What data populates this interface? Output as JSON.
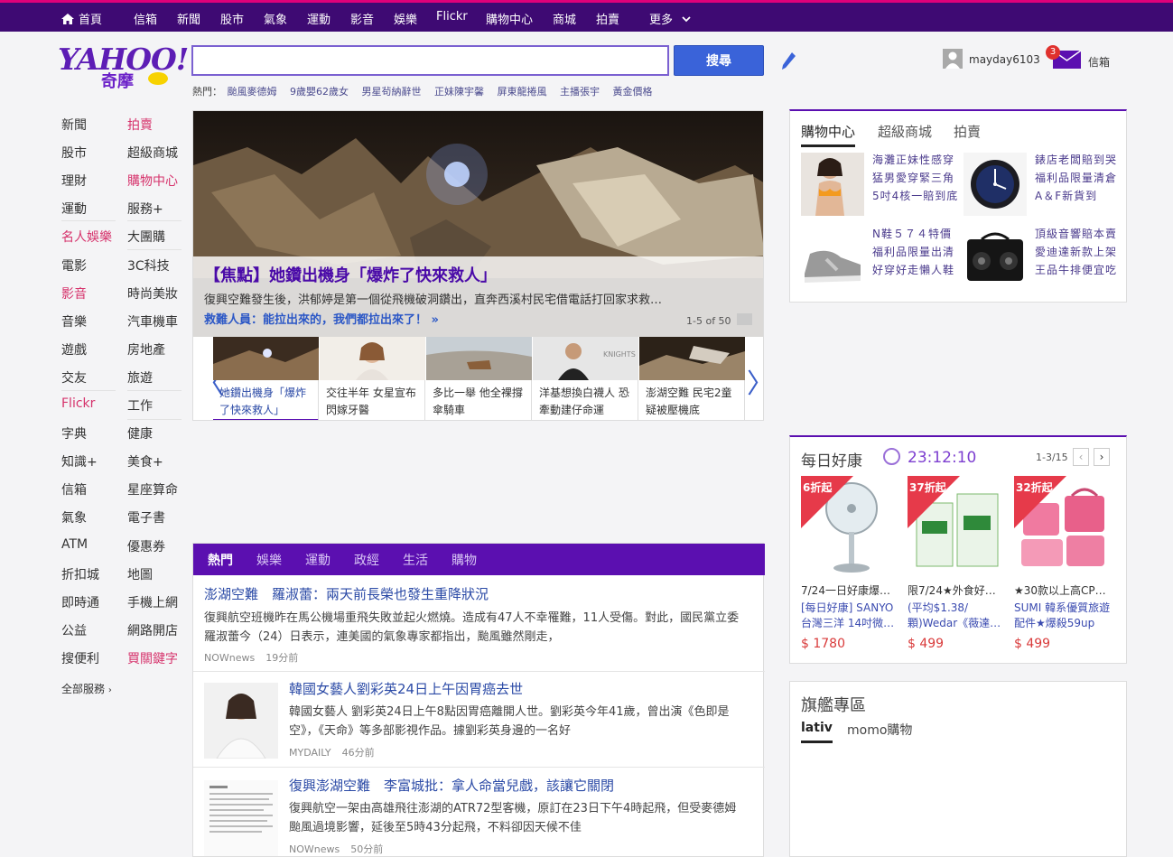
{
  "topnav": {
    "items": [
      "首頁",
      "信箱",
      "新聞",
      "股市",
      "氣象",
      "運動",
      "影音",
      "娛樂",
      "Flickr",
      "購物中心",
      "商城",
      "拍賣",
      "更多"
    ]
  },
  "header": {
    "logo_text": "YAHOO!",
    "logo_sub": "奇摩",
    "search_placeholder": "",
    "search_button": "搜尋",
    "hot_label": "熱門：",
    "hot_links": [
      "颱風麥德姆",
      "9歲嬰62歲女",
      "男星茍納辭世",
      "正妹陳宇馨",
      "屏東龍捲風",
      "主播張宇",
      "黃金價格"
    ],
    "username": "mayday6103",
    "mail_count": "3",
    "mail_label": "信箱"
  },
  "leftnav": {
    "col1": [
      {
        "label": "新聞",
        "red": false
      },
      {
        "label": "股市",
        "red": false
      },
      {
        "label": "理財",
        "red": false
      },
      {
        "label": "運動",
        "red": false
      },
      {
        "label": "名人娛樂",
        "red": true
      },
      {
        "label": "電影",
        "red": false
      },
      {
        "label": "影音",
        "red": true
      },
      {
        "label": "音樂",
        "red": false
      },
      {
        "label": "遊戲",
        "red": false
      },
      {
        "label": "交友",
        "red": false
      },
      {
        "label": "Flickr",
        "red": true
      },
      {
        "label": "字典",
        "red": false
      },
      {
        "label": "知識+",
        "red": false
      },
      {
        "label": "信箱",
        "red": false
      },
      {
        "label": "氣象",
        "red": false
      },
      {
        "label": "ATM",
        "red": false
      },
      {
        "label": "折扣城",
        "red": false
      },
      {
        "label": "即時通",
        "red": false
      },
      {
        "label": "公益",
        "red": false
      },
      {
        "label": "搜便利",
        "red": false
      }
    ],
    "col2": [
      {
        "label": "拍賣",
        "red": true
      },
      {
        "label": "超級商城",
        "red": false
      },
      {
        "label": "購物中心",
        "red": true
      },
      {
        "label": "服務+",
        "red": false
      },
      {
        "label": "大團購",
        "red": false
      },
      {
        "label": "3C科技",
        "red": false
      },
      {
        "label": "時尚美妝",
        "red": false
      },
      {
        "label": "汽車機車",
        "red": false
      },
      {
        "label": "房地產",
        "red": false
      },
      {
        "label": "旅遊",
        "red": false
      },
      {
        "label": "工作",
        "red": false
      },
      {
        "label": "健康",
        "red": false
      },
      {
        "label": "美食+",
        "red": false
      },
      {
        "label": "星座算命",
        "red": false
      },
      {
        "label": "電子書",
        "red": false
      },
      {
        "label": "優惠券",
        "red": false
      },
      {
        "label": "地圖",
        "red": false
      },
      {
        "label": "手機上網",
        "red": false
      },
      {
        "label": "網路開店",
        "red": false
      },
      {
        "label": "買關鍵字",
        "red": true
      }
    ],
    "all_services": "全部服務"
  },
  "hero": {
    "title": "【焦點】她鑽出機身「爆炸了快來救人」",
    "desc": "復興空難發生後，洪郁婷是第一個從飛機破洞鑽出，直奔西溪村民宅借電話打回家求救…",
    "more": "救難人員：能拉出來的，我們都拉出來了！ »",
    "count": "1-5 of 50",
    "thumbs": [
      {
        "caption": "她鑽出機身「爆炸了快來救人」"
      },
      {
        "caption": "交往半年 女星宣布閃嫁牙醫"
      },
      {
        "caption": "多比一舉 他全裸撐傘騎車"
      },
      {
        "caption": "洋基想換白襪人 恐牽動建仔命運"
      },
      {
        "caption": "澎湖空難 民宅2童疑被壓機底"
      }
    ]
  },
  "news": {
    "tabs": [
      "熱門",
      "娛樂",
      "運動",
      "政經",
      "生活",
      "購物"
    ],
    "items": [
      {
        "title": "澎湖空難　羅淑蕾：兩天前長榮也發生重降狀況",
        "body": "復興航空班機昨在馬公機場重飛失敗並起火燃燒。造成有47人不幸罹難，11人受傷。對此，國民黨立委羅淑蕾今（24）日表示，連美國的氣象專家都指出，颱風雖然剛走，",
        "source": "NOWnews",
        "time": "19分前"
      },
      {
        "title": "韓國女藝人劉彩英24日上午因胃癌去世",
        "body": "韓國女藝人 劉彩英24日上午8點因胃癌離開人世。劉彩英今年41歲，曾出演《色即是空》，《天命》等多部影視作品。據劉彩英身邊的一名好",
        "source": "MYDAILY",
        "time": "46分前"
      },
      {
        "title": "復興澎湖空難　李富城批：拿人命當兒戲，該讓它關閉",
        "body": "復興航空一架由高雄飛往澎湖的ATR72型客機，原訂在23日下午4時起飛，但受麥德姆颱風過境影響，延後至5時43分起飛，不料卻因天候不佳",
        "source": "NOWnews",
        "time": "50分前"
      }
    ]
  },
  "shop": {
    "tabs": [
      "購物中心",
      "超級商城",
      "拍賣"
    ],
    "items": [
      {
        "text": "海灘正妹性感穿 猛男愛穿緊三角 5吋4核一賠到底"
      },
      {
        "text": "錶店老闆賠到哭 福利品限量清倉 A＆F新貨到"
      },
      {
        "text": "N鞋５７４特價 福利品限量出清 好穿好走懶人鞋"
      },
      {
        "text": "頂級音響賠本賣 愛迪達新款上架 王品牛排便宜吃"
      }
    ]
  },
  "deals": {
    "title": "每日好康",
    "time": "23:12:10",
    "page": "1-3/15",
    "items": [
      {
        "badge": "6折起",
        "line1": "7/24一日好康爆…",
        "line2": "[每日好康] SANYO 台灣三洋 14吋微…",
        "price": "$ 1780",
        "color": "#dfe8ee"
      },
      {
        "badge": "37折起",
        "line1": "限7/24★外食好…",
        "line2": "(平均$1.38/顆)Wedar《薇達…",
        "price": "$ 499",
        "color": "#e5f3e4"
      },
      {
        "badge": "32折起",
        "line1": "★30款以上高CP…",
        "line2": "SUMI 韓系優質旅遊配件★爆殺59up",
        "price": "$ 499",
        "color": "#f4c6d5"
      }
    ]
  },
  "flag": {
    "title": "旗艦專區",
    "tabs": [
      "lativ",
      "momo購物"
    ]
  }
}
